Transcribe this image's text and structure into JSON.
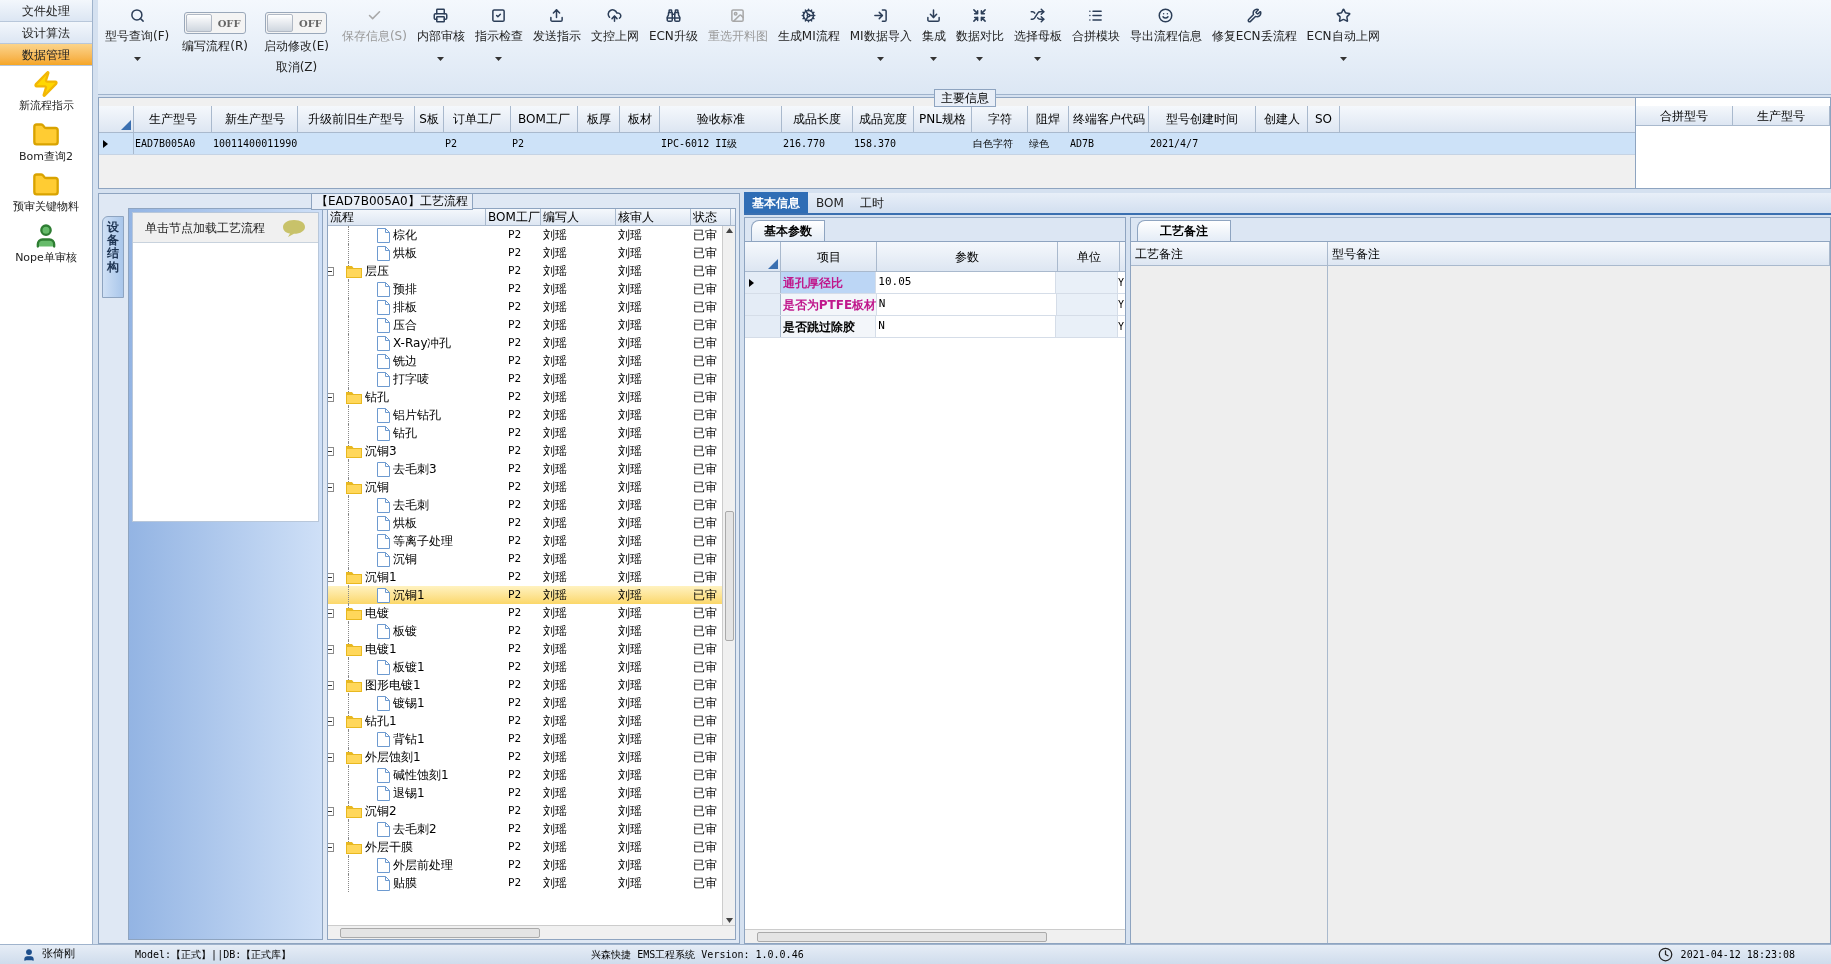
{
  "nav": {
    "tabs": [
      {
        "label": "文件处理",
        "selected": false
      },
      {
        "label": "设计算法",
        "selected": false
      },
      {
        "label": "数据管理",
        "selected": true
      }
    ],
    "items": [
      {
        "kind": "lightning",
        "label": "新流程指示"
      },
      {
        "kind": "folder",
        "label": "Bom查询2"
      },
      {
        "kind": "folder",
        "label": "预审关键物料"
      },
      {
        "kind": "person",
        "label": "Nope单审核"
      }
    ]
  },
  "toolbar": [
    {
      "kind": "button",
      "label": "型号查询(F)",
      "disabled": false,
      "dropdown": true
    },
    {
      "kind": "toggle",
      "label": "编写流程(R)",
      "switch_text": "OFF",
      "on": false
    },
    {
      "kind": "toggle",
      "label": "启动修改(E)",
      "switch_text": "OFF",
      "on": false,
      "secondary": "取消(Z)"
    },
    {
      "kind": "button",
      "label": "保存信息(S)",
      "disabled": true,
      "dropdown": false
    },
    {
      "kind": "button",
      "label": "内部审核",
      "disabled": false,
      "dropdown": true
    },
    {
      "kind": "button",
      "label": "指示检查",
      "disabled": false,
      "dropdown": true
    },
    {
      "kind": "button",
      "label": "发送指示",
      "disabled": false,
      "dropdown": false
    },
    {
      "kind": "button",
      "label": "文控上网",
      "disabled": false,
      "dropdown": false
    },
    {
      "kind": "button",
      "label": "ECN升级",
      "disabled": false,
      "dropdown": false
    },
    {
      "kind": "button",
      "label": "重选开料图",
      "disabled": true,
      "dropdown": false
    },
    {
      "kind": "button",
      "label": "生成MI流程",
      "disabled": false,
      "dropdown": false
    },
    {
      "kind": "button",
      "label": "MI数据导入",
      "disabled": false,
      "dropdown": true
    },
    {
      "kind": "button",
      "label": "集成",
      "disabled": false,
      "dropdown": true
    },
    {
      "kind": "button",
      "label": "数据对比",
      "disabled": false,
      "dropdown": true
    },
    {
      "kind": "button",
      "label": "选择母板",
      "disabled": false,
      "dropdown": true
    },
    {
      "kind": "button",
      "label": "合拼模块",
      "disabled": false,
      "dropdown": false
    },
    {
      "kind": "button",
      "label": "导出流程信息",
      "disabled": false,
      "dropdown": false
    },
    {
      "kind": "button",
      "label": "修复ECN丢流程",
      "disabled": false,
      "dropdown": false
    },
    {
      "kind": "button",
      "label": "ECN自动上网",
      "disabled": false,
      "dropdown": true
    }
  ],
  "main_info": {
    "title": "主要信息",
    "columns": [
      "生产型号",
      "新生产型号",
      "升级前旧生产型号",
      "S板",
      "订单工厂",
      "BOM工厂",
      "板厚",
      "板材",
      "验收标准",
      "成品长度",
      "成品宽度",
      "PNL规格",
      "字符",
      "阻焊",
      "终端客户代码",
      "型号创建时间",
      "创建人",
      "SO"
    ],
    "rows": [
      {
        "selected": true,
        "cells": [
          "EAD7B005A0",
          "10011400011990",
          null,
          null,
          "P2",
          "P2",
          null,
          null,
          "IPC-6012 II级",
          "216.770",
          "158.370",
          null,
          "白色字符",
          "绿色",
          "AD7B",
          "2021/4/7",
          null,
          null
        ]
      }
    ],
    "side_columns": [
      "合拼型号",
      "生产型号"
    ]
  },
  "process_panel": {
    "title": "【EAD7B005A0】工艺流程",
    "side_tab": "设备结构",
    "hint": "单击节点加载工艺流程",
    "columns": [
      "流程",
      "BOM工厂",
      "编写人",
      "核审人",
      "状态"
    ],
    "tree": [
      {
        "kind": "file",
        "name": "棕化",
        "bom": "P2",
        "writer": "刘瑶",
        "reviewer": "刘瑶",
        "status": "已审",
        "selected": false
      },
      {
        "kind": "file",
        "name": "烘板",
        "bom": "P2",
        "writer": "刘瑶",
        "reviewer": "刘瑶",
        "status": "已审",
        "selected": false
      },
      {
        "kind": "folder",
        "name": "层压",
        "bom": "P2",
        "writer": "刘瑶",
        "reviewer": "刘瑶",
        "status": "已审",
        "selected": false,
        "expanded": true,
        "children": [
          {
            "kind": "file",
            "name": "预排",
            "bom": "P2",
            "writer": "刘瑶",
            "reviewer": "刘瑶",
            "status": "已审",
            "selected": false
          },
          {
            "kind": "file",
            "name": "排板",
            "bom": "P2",
            "writer": "刘瑶",
            "reviewer": "刘瑶",
            "status": "已审",
            "selected": false
          },
          {
            "kind": "file",
            "name": "压合",
            "bom": "P2",
            "writer": "刘瑶",
            "reviewer": "刘瑶",
            "status": "已审",
            "selected": false
          },
          {
            "kind": "file",
            "name": "X-Ray冲孔",
            "bom": "P2",
            "writer": "刘瑶",
            "reviewer": "刘瑶",
            "status": "已审",
            "selected": false
          },
          {
            "kind": "file",
            "name": "铣边",
            "bom": "P2",
            "writer": "刘瑶",
            "reviewer": "刘瑶",
            "status": "已审",
            "selected": false
          },
          {
            "kind": "file",
            "name": "打字唛",
            "bom": "P2",
            "writer": "刘瑶",
            "reviewer": "刘瑶",
            "status": "已审",
            "selected": false
          }
        ]
      },
      {
        "kind": "folder",
        "name": "钻孔",
        "bom": "P2",
        "writer": "刘瑶",
        "reviewer": "刘瑶",
        "status": "已审",
        "selected": false,
        "expanded": true,
        "children": [
          {
            "kind": "file",
            "name": "铝片钻孔",
            "bom": "P2",
            "writer": "刘瑶",
            "reviewer": "刘瑶",
            "status": "已审",
            "selected": false
          },
          {
            "kind": "file",
            "name": "钻孔",
            "bom": "P2",
            "writer": "刘瑶",
            "reviewer": "刘瑶",
            "status": "已审",
            "selected": false
          }
        ]
      },
      {
        "kind": "folder",
        "name": "沉铜3",
        "bom": "P2",
        "writer": "刘瑶",
        "reviewer": "刘瑶",
        "status": "已审",
        "selected": false,
        "expanded": true,
        "children": [
          {
            "kind": "file",
            "name": "去毛刺3",
            "bom": "P2",
            "writer": "刘瑶",
            "reviewer": "刘瑶",
            "status": "已审",
            "selected": false
          }
        ]
      },
      {
        "kind": "folder",
        "name": "沉铜",
        "bom": "P2",
        "writer": "刘瑶",
        "reviewer": "刘瑶",
        "status": "已审",
        "selected": false,
        "expanded": true,
        "children": [
          {
            "kind": "file",
            "name": "去毛刺",
            "bom": "P2",
            "writer": "刘瑶",
            "reviewer": "刘瑶",
            "status": "已审",
            "selected": false
          },
          {
            "kind": "file",
            "name": "烘板",
            "bom": "P2",
            "writer": "刘瑶",
            "reviewer": "刘瑶",
            "status": "已审",
            "selected": false
          },
          {
            "kind": "file",
            "name": "等离子处理",
            "bom": "P2",
            "writer": "刘瑶",
            "reviewer": "刘瑶",
            "status": "已审",
            "selected": false
          },
          {
            "kind": "file",
            "name": "沉铜",
            "bom": "P2",
            "writer": "刘瑶",
            "reviewer": "刘瑶",
            "status": "已审",
            "selected": false
          }
        ]
      },
      {
        "kind": "folder",
        "name": "沉铜1",
        "bom": "P2",
        "writer": "刘瑶",
        "reviewer": "刘瑶",
        "status": "已审",
        "selected": false,
        "expanded": true,
        "children": [
          {
            "kind": "file",
            "name": "沉铜1",
            "bom": "P2",
            "writer": "刘瑶",
            "reviewer": "刘瑶",
            "status": "已审",
            "selected": true
          }
        ]
      },
      {
        "kind": "folder",
        "name": "电镀",
        "bom": "P2",
        "writer": "刘瑶",
        "reviewer": "刘瑶",
        "status": "已审",
        "selected": false,
        "expanded": true,
        "children": [
          {
            "kind": "file",
            "name": "板镀",
            "bom": "P2",
            "writer": "刘瑶",
            "reviewer": "刘瑶",
            "status": "已审",
            "selected": false
          }
        ]
      },
      {
        "kind": "folder",
        "name": "电镀1",
        "bom": "P2",
        "writer": "刘瑶",
        "reviewer": "刘瑶",
        "status": "已审",
        "selected": false,
        "expanded": true,
        "children": [
          {
            "kind": "file",
            "name": "板镀1",
            "bom": "P2",
            "writer": "刘瑶",
            "reviewer": "刘瑶",
            "status": "已审",
            "selected": false
          }
        ]
      },
      {
        "kind": "folder",
        "name": "图形电镀1",
        "bom": "P2",
        "writer": "刘瑶",
        "reviewer": "刘瑶",
        "status": "已审",
        "selected": false,
        "expanded": true,
        "children": [
          {
            "kind": "file",
            "name": "镀锡1",
            "bom": "P2",
            "writer": "刘瑶",
            "reviewer": "刘瑶",
            "status": "已审",
            "selected": false
          }
        ]
      },
      {
        "kind": "folder",
        "name": "钻孔1",
        "bom": "P2",
        "writer": "刘瑶",
        "reviewer": "刘瑶",
        "status": "已审",
        "selected": false,
        "expanded": true,
        "children": [
          {
            "kind": "file",
            "name": "背钻1",
            "bom": "P2",
            "writer": "刘瑶",
            "reviewer": "刘瑶",
            "status": "已审",
            "selected": false
          }
        ]
      },
      {
        "kind": "folder",
        "name": "外层蚀刻1",
        "bom": "P2",
        "writer": "刘瑶",
        "reviewer": "刘瑶",
        "status": "已审",
        "selected": false,
        "expanded": true,
        "children": [
          {
            "kind": "file",
            "name": "碱性蚀刻1",
            "bom": "P2",
            "writer": "刘瑶",
            "reviewer": "刘瑶",
            "status": "已审",
            "selected": false
          },
          {
            "kind": "file",
            "name": "退锡1",
            "bom": "P2",
            "writer": "刘瑶",
            "reviewer": "刘瑶",
            "status": "已审",
            "selected": false
          }
        ]
      },
      {
        "kind": "folder",
        "name": "沉铜2",
        "bom": "P2",
        "writer": "刘瑶",
        "reviewer": "刘瑶",
        "status": "已审",
        "selected": false,
        "expanded": true,
        "children": [
          {
            "kind": "file",
            "name": "去毛刺2",
            "bom": "P2",
            "writer": "刘瑶",
            "reviewer": "刘瑶",
            "status": "已审",
            "selected": false
          }
        ]
      },
      {
        "kind": "folder",
        "name": "外层干膜",
        "bom": "P2",
        "writer": "刘瑶",
        "reviewer": "刘瑶",
        "status": "已审",
        "selected": false,
        "expanded": true,
        "children": [
          {
            "kind": "file",
            "name": "外层前处理",
            "bom": "P2",
            "writer": "刘瑶",
            "reviewer": "刘瑶",
            "status": "已审",
            "selected": false
          },
          {
            "kind": "file",
            "name": "贴膜",
            "bom": "P2",
            "writer": "刘瑶",
            "reviewer": "刘瑶",
            "status": "已审",
            "selected": false
          }
        ]
      }
    ]
  },
  "detail_tabs": [
    {
      "label": "基本信息",
      "selected": true
    },
    {
      "label": "BOM",
      "selected": false
    },
    {
      "label": "工时",
      "selected": false
    }
  ],
  "params": {
    "tab": "基本参数",
    "columns": [
      "项目",
      "参数",
      "单位"
    ],
    "rows": [
      {
        "item": "通孔厚径比",
        "value": "10.05",
        "flag": "Y",
        "color": "#c0188c",
        "selected": true
      },
      {
        "item": "是否为PTFE板材",
        "value": "N",
        "flag": "Y",
        "color": "#c0188c",
        "selected": false
      },
      {
        "item": "是否跳过除胶",
        "value": "N",
        "flag": "Y",
        "color": "#000000",
        "selected": false
      }
    ]
  },
  "notes": {
    "tab": "工艺备注",
    "columns": [
      "工艺备注",
      "型号备注"
    ]
  },
  "status_bar": {
    "user": "张倚刚",
    "model": "Model:【正式】||DB:【正式库】",
    "system": "兴森快捷 EMS工程系统 Version: 1.0.0.46",
    "datetime": "2021-04-12 18:23:08"
  }
}
